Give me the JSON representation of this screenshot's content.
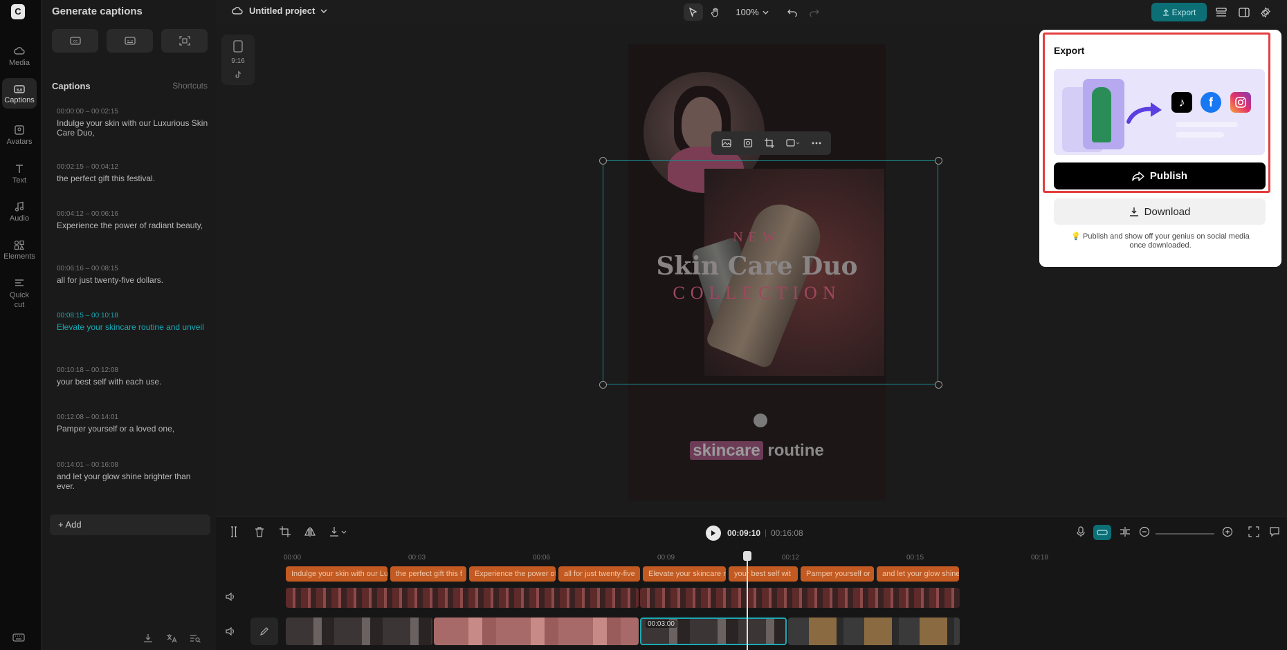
{
  "rail": {
    "items": [
      {
        "label": "Media",
        "icon": "cloud-icon"
      },
      {
        "label": "Captions",
        "icon": "captions-icon"
      },
      {
        "label": "Avatars",
        "icon": "avatar-icon"
      },
      {
        "label": "Text",
        "icon": "text-icon"
      },
      {
        "label": "Audio",
        "icon": "music-icon"
      },
      {
        "label": "Elements",
        "icon": "elements-icon"
      },
      {
        "label": "Quick",
        "label2": "cut",
        "icon": "quick-cut-icon"
      }
    ],
    "active": "Captions"
  },
  "captions_panel": {
    "title": "Generate captions",
    "header": "Captions",
    "shortcuts": "Shortcuts",
    "items": [
      {
        "time": "00:00:00 – 00:02:15",
        "text": "Indulge your skin with our Luxurious Skin Care Duo,"
      },
      {
        "time": "00:02:15 – 00:04:12",
        "text": "the perfect gift this festival."
      },
      {
        "time": "00:04:12 – 00:06:16",
        "text": "Experience the power of radiant beauty,"
      },
      {
        "time": "00:06:16 – 00:08:15",
        "text": "all for just twenty-five dollars."
      },
      {
        "time": "00:08:15 – 00:10:18",
        "text": "Elevate your skincare routine and unveil"
      },
      {
        "time": "00:10:18 – 00:12:08",
        "text": "your best self with each use."
      },
      {
        "time": "00:12:08 – 00:14:01",
        "text": "Pamper yourself or a loved one,"
      },
      {
        "time": "00:14:01 – 00:16:08",
        "text": "and let your glow shine brighter than ever."
      }
    ],
    "active_index": 4,
    "add_label": "Add"
  },
  "topbar": {
    "project_title": "Untitled project",
    "zoom": "100%",
    "export_label": "Export"
  },
  "canvas": {
    "ratio_label": "9:16",
    "video_new": "NEW",
    "video_title": "Skin Care Duo",
    "video_collection": "COLLECTION",
    "subtitle_highlight": "skincare",
    "subtitle_rest": "routine"
  },
  "export_popup": {
    "title": "Export",
    "publish_label": "Publish",
    "download_label": "Download",
    "note": "Publish and show off your genius on social media once downloaded."
  },
  "timeline": {
    "current_time": "00:09:10",
    "total_time": "00:16:08",
    "ruler_labels": [
      "00:00",
      "00:03",
      "00:06",
      "00:09",
      "00:12",
      "00:15",
      "00:18"
    ],
    "caption_clips": [
      "Indulge your skin with our Lux",
      "the perfect gift this f",
      "Experience the power of",
      "all for just twenty-five",
      "Elevate your skincare ro",
      "your best self wit",
      "Pamper yourself or",
      "and let your glow shine br"
    ],
    "clip_time_label": "00:03:00"
  },
  "colors": {
    "accent": "#0d6f76",
    "highlight": "#e33d3d",
    "caption_active": "#1ba9b5",
    "caption_clip": "#c25a22"
  }
}
